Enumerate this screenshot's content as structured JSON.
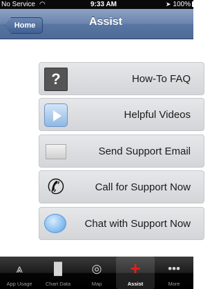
{
  "status_bar": {
    "carrier": "No Service",
    "wifi_icon": "wifi-icon",
    "time": "9:33 AM",
    "location_icon": "location-arrow-icon",
    "battery": "100%"
  },
  "nav": {
    "back_label": "Home",
    "title": "Assist"
  },
  "rows": [
    {
      "label": "How-To FAQ",
      "icon": "question-icon"
    },
    {
      "label": "Helpful Videos",
      "icon": "video-play-icon"
    },
    {
      "label": "Send Support Email",
      "icon": "envelope-icon"
    },
    {
      "label": "Call for Support Now",
      "icon": "phone-icon"
    },
    {
      "label": "Chat with Support Now",
      "icon": "chat-bubble-icon"
    }
  ],
  "tabs": [
    {
      "label": "App Usage",
      "icon": "app-usage-icon"
    },
    {
      "label": "Chart Data",
      "icon": "bar-chart-icon"
    },
    {
      "label": "Map",
      "icon": "globe-icon"
    },
    {
      "label": "Assist",
      "icon": "red-cross-icon",
      "active": true
    },
    {
      "label": "More",
      "icon": "more-dots-icon"
    }
  ],
  "colors": {
    "nav_bar": "#5a76a2",
    "active_tab_icon": "#e0201b"
  }
}
